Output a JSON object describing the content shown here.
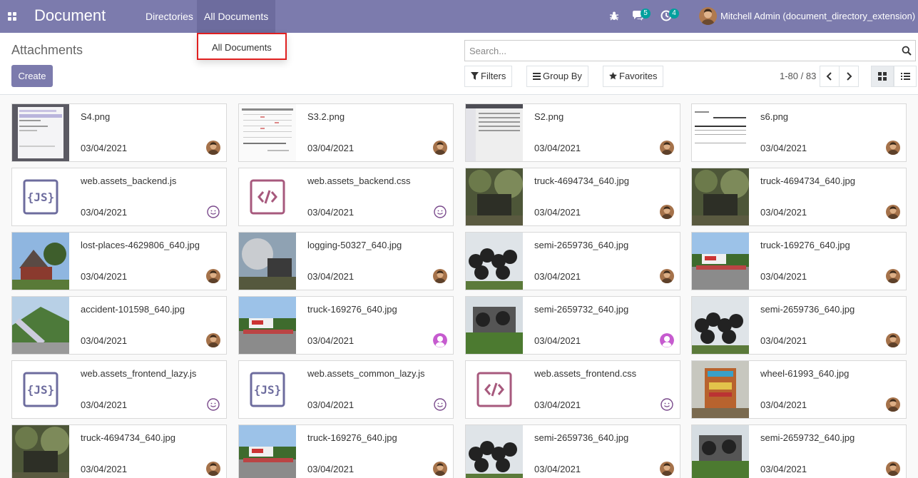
{
  "app": {
    "title": "Document"
  },
  "menu": {
    "directories": "Directories",
    "all_documents": "All Documents"
  },
  "systray": {
    "messages_count": "5",
    "activities_count": "4",
    "user_name": "Mitchell Admin (document_directory_extension)"
  },
  "dropdown": {
    "item": "All Documents"
  },
  "control_panel": {
    "breadcrumb": "Attachments",
    "create_label": "Create",
    "search_placeholder": "Search...",
    "filters_label": "Filters",
    "groupby_label": "Group By",
    "favorites_label": "Favorites",
    "pager": "1-80 / 83"
  },
  "colors": {
    "navbar": "#7c7bad",
    "badge": "#00a09d",
    "highlight_border": "#e02020"
  },
  "cards": [
    {
      "name": "S4.png",
      "date": "03/04/2021",
      "thumb": "screenshot-dark",
      "owner": "photo"
    },
    {
      "name": "S3.2.png",
      "date": "03/04/2021",
      "thumb": "screenshot-table",
      "owner": "photo"
    },
    {
      "name": "S2.png",
      "date": "03/04/2021",
      "thumb": "screenshot-list",
      "owner": "photo"
    },
    {
      "name": "s6.png",
      "date": "03/04/2021",
      "thumb": "screenshot-report",
      "owner": "photo"
    },
    {
      "name": "web.assets_backend.js",
      "date": "03/04/2021",
      "thumb": "js-icon",
      "owner": "smiley"
    },
    {
      "name": "web.assets_backend.css",
      "date": "03/04/2021",
      "thumb": "css-icon",
      "owner": "smiley"
    },
    {
      "name": "truck-4694734_640.jpg",
      "date": "03/04/2021",
      "thumb": "photo-forest",
      "owner": "photo"
    },
    {
      "name": "truck-4694734_640.jpg",
      "date": "03/04/2021",
      "thumb": "photo-forest",
      "owner": "photo"
    },
    {
      "name": "lost-places-4629806_640.jpg",
      "date": "03/04/2021",
      "thumb": "photo-sky",
      "owner": "photo"
    },
    {
      "name": "logging-50327_640.jpg",
      "date": "03/04/2021",
      "thumb": "photo-smoke",
      "owner": "photo"
    },
    {
      "name": "semi-2659736_640.jpg",
      "date": "03/04/2021",
      "thumb": "photo-tires",
      "owner": "photo"
    },
    {
      "name": "truck-169276_640.jpg",
      "date": "03/04/2021",
      "thumb": "photo-road",
      "owner": "photo"
    },
    {
      "name": "accident-101598_640.jpg",
      "date": "03/04/2021",
      "thumb": "photo-hill",
      "owner": "photo"
    },
    {
      "name": "truck-169276_640.jpg",
      "date": "03/04/2021",
      "thumb": "photo-road",
      "owner": "person"
    },
    {
      "name": "semi-2659732_640.jpg",
      "date": "03/04/2021",
      "thumb": "photo-grass",
      "owner": "person"
    },
    {
      "name": "semi-2659736_640.jpg",
      "date": "03/04/2021",
      "thumb": "photo-tires",
      "owner": "photo"
    },
    {
      "name": "web.assets_frontend_lazy.js",
      "date": "03/04/2021",
      "thumb": "js-icon",
      "owner": "smiley"
    },
    {
      "name": "web.assets_common_lazy.js",
      "date": "03/04/2021",
      "thumb": "js-icon",
      "owner": "smiley"
    },
    {
      "name": "web.assets_frontend.css",
      "date": "03/04/2021",
      "thumb": "css-icon",
      "owner": "smiley"
    },
    {
      "name": "wheel-61993_640.jpg",
      "date": "03/04/2021",
      "thumb": "photo-colorful",
      "owner": "photo"
    },
    {
      "name": "truck-4694734_640.jpg",
      "date": "03/04/2021",
      "thumb": "photo-forest",
      "owner": "photo"
    },
    {
      "name": "truck-169276_640.jpg",
      "date": "03/04/2021",
      "thumb": "photo-road",
      "owner": "photo"
    },
    {
      "name": "semi-2659736_640.jpg",
      "date": "03/04/2021",
      "thumb": "photo-tires",
      "owner": "photo"
    },
    {
      "name": "semi-2659732_640.jpg",
      "date": "03/04/2021",
      "thumb": "photo-grass",
      "owner": "photo"
    }
  ]
}
